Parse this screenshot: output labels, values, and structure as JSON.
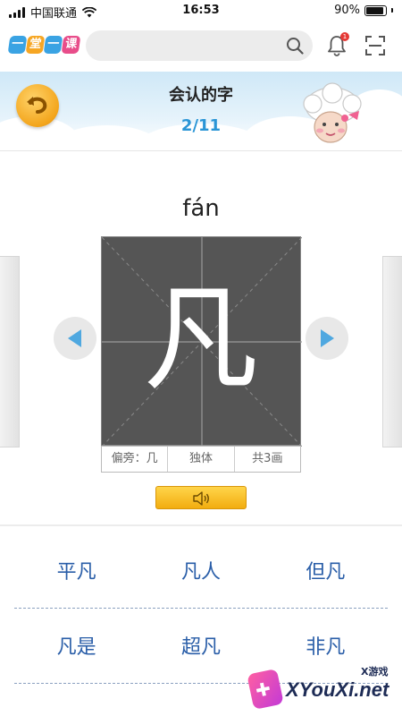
{
  "status_bar": {
    "carrier": "中国联通",
    "time": "16:53",
    "battery": "90%",
    "battery_level": 0.9
  },
  "topbar": {
    "logo_chars": [
      "一",
      "堂",
      "一",
      "课"
    ],
    "search_icon": "search-icon",
    "bell_icon": "bell-icon",
    "bell_badge": "1",
    "scan_icon": "scan-icon"
  },
  "header": {
    "title": "会认的字",
    "progress": "2/11",
    "back_icon": "back-arrow-icon"
  },
  "character": {
    "pinyin": "fán",
    "glyph": "凡",
    "radical": "偏旁：几",
    "structure": "独体",
    "strokes": "共3画"
  },
  "words": [
    [
      "平凡",
      "凡人",
      "但凡"
    ],
    [
      "凡是",
      "超凡",
      "非凡"
    ]
  ],
  "watermark": {
    "brand": "XYouXi.net",
    "tag": "X游戏"
  },
  "colors": {
    "accent_blue": "#2a95d6",
    "card_bg": "#555555",
    "word_color": "#2a5ea8",
    "button_yellow": "#f2ad10"
  }
}
